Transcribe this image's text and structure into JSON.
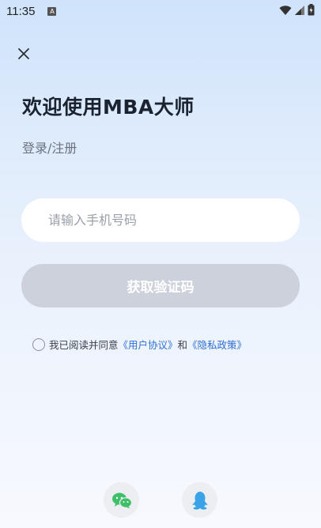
{
  "status_bar": {
    "time": "11:35",
    "notification_icon": "A"
  },
  "header": {
    "close_icon": "close-icon"
  },
  "login": {
    "title": "欢迎使用MBA大师",
    "subtitle": "登录/注册",
    "phone_placeholder": "请输入手机号码",
    "phone_value": "",
    "get_code_label": "获取验证码"
  },
  "agreement": {
    "prefix": "我已阅读并同意",
    "user_agreement": "《用户协议》",
    "conjunction": "和",
    "privacy_policy": "《隐私政策》",
    "checked": false
  },
  "social_login": {
    "items": [
      "wechat-icon",
      "qq-icon"
    ]
  },
  "colors": {
    "button_disabled": "#cdd1db",
    "link": "#2f6fd6",
    "title_text": "#1c2330"
  }
}
